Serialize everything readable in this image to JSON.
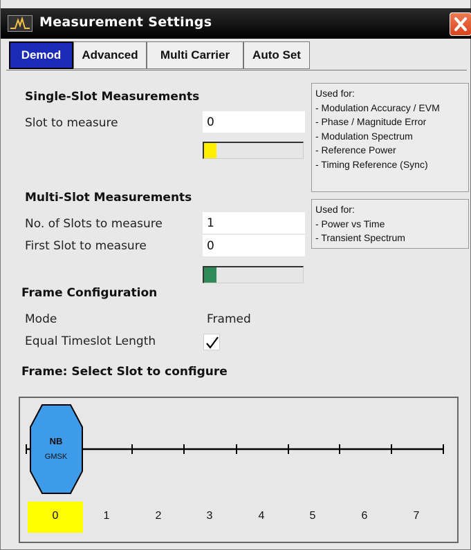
{
  "window": {
    "title": "Measurement Settings"
  },
  "tabs": [
    {
      "label": "Demod",
      "active": true
    },
    {
      "label": "Advanced",
      "active": false
    },
    {
      "label": "Multi Carrier",
      "active": false
    },
    {
      "label": "Auto Set",
      "active": false
    }
  ],
  "single_slot": {
    "heading": "Single-Slot Measurements",
    "slot_label": "Slot to measure",
    "slot_value": "0",
    "progress_color": "#ffee00",
    "info_title": "Used for:",
    "info_items": [
      "- Modulation Accuracy / EVM",
      "- Phase / Magnitude Error",
      "- Modulation Spectrum",
      "- Reference Power",
      "- Timing Reference (Sync)"
    ]
  },
  "multi_slot": {
    "heading": "Multi-Slot Measurements",
    "count_label": "No. of Slots to measure",
    "count_value": "1",
    "first_label": "First Slot to measure",
    "first_value": "0",
    "progress_color": "#2e8b57",
    "info_title": "Used for:",
    "info_items": [
      "- Power vs Time",
      "- Transient Spectrum"
    ]
  },
  "frame_config": {
    "heading": "Frame Configuration",
    "mode_label": "Mode",
    "mode_value": "Framed",
    "equal_label": "Equal Timeslot Length",
    "equal_checked": true
  },
  "frame_select": {
    "heading": "Frame: Select Slot to configure",
    "slot_burst": "NB",
    "slot_modulation": "GMSK",
    "slots": [
      "0",
      "1",
      "2",
      "3",
      "4",
      "5",
      "6",
      "7"
    ],
    "selected_slot": "0",
    "selected_color": "#ffff00",
    "burst_color": "#3d9be9"
  },
  "icons": {
    "app": "spectrum-icon",
    "close": "close-icon",
    "check": "checkmark-icon"
  }
}
